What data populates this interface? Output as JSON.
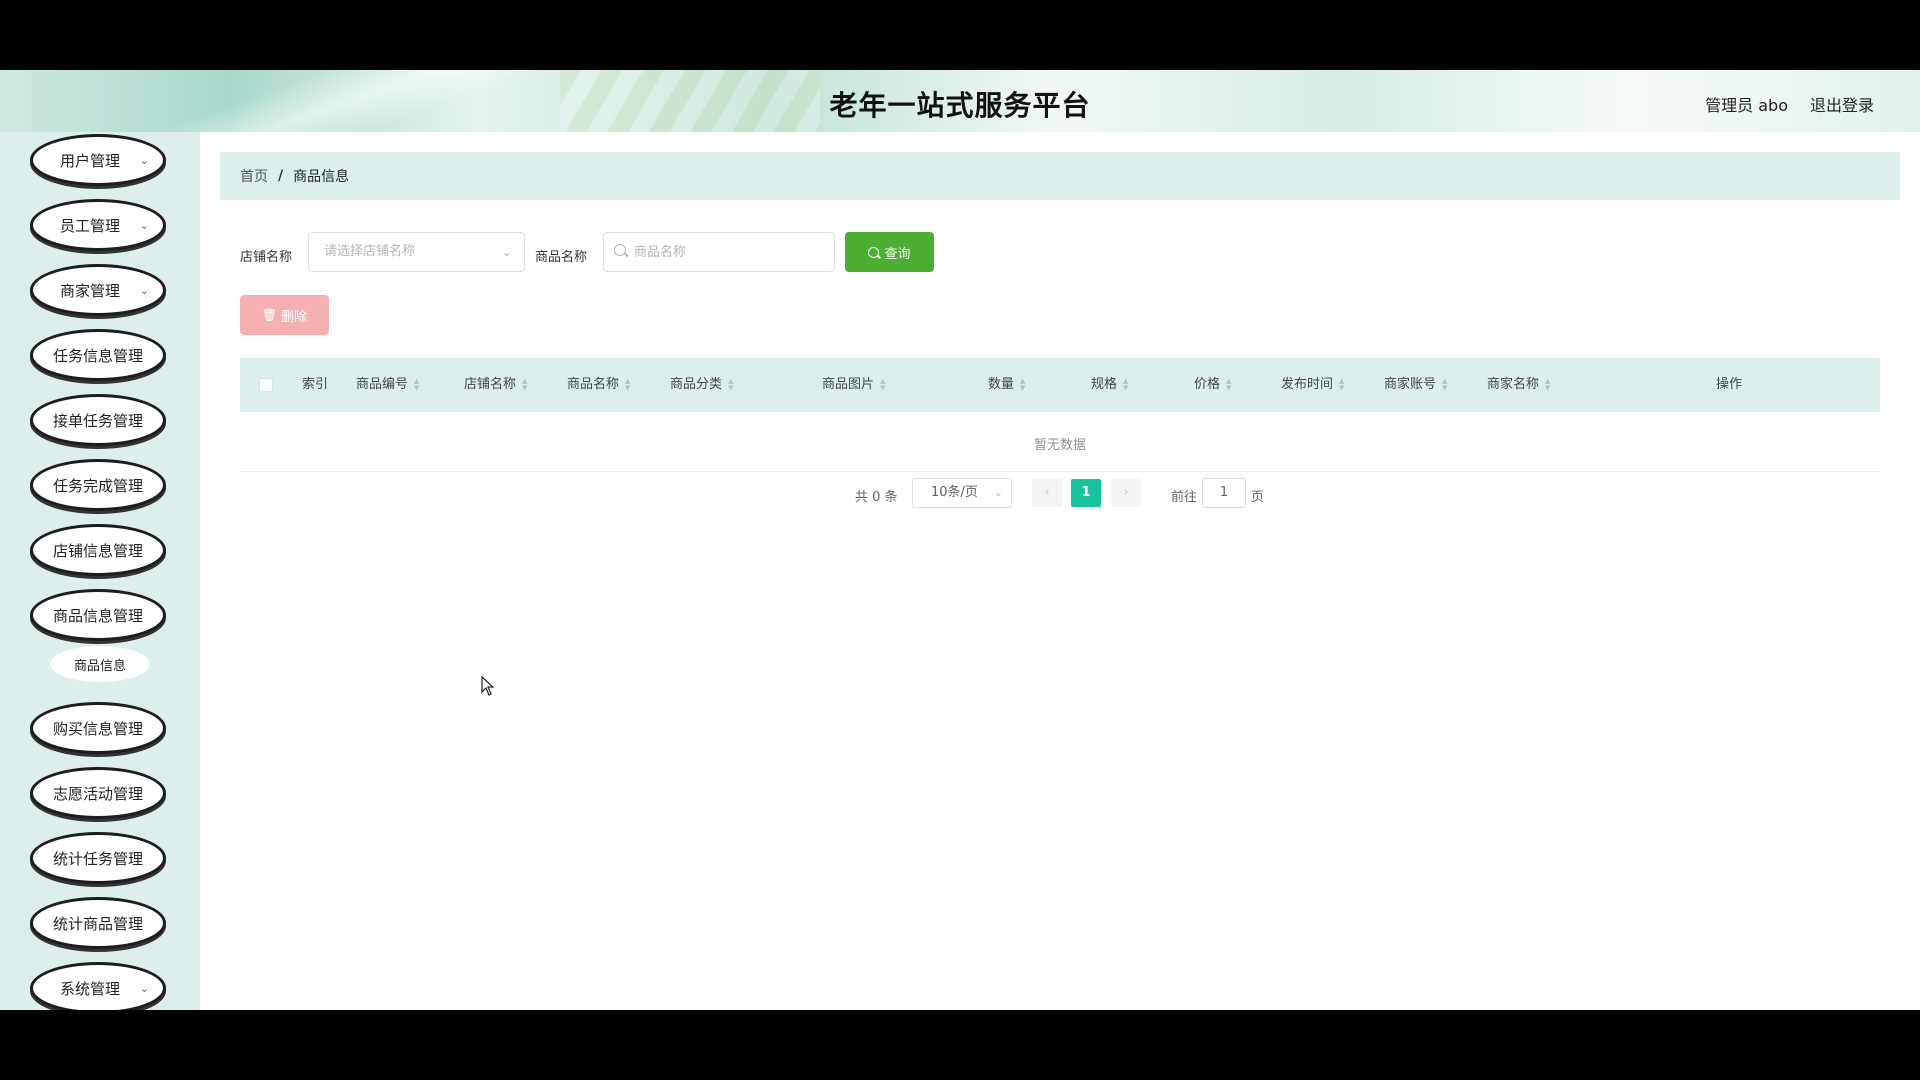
{
  "header": {
    "title": "老年一站式服务平台",
    "user": "管理员 abo",
    "logout": "退出登录"
  },
  "sidebar": {
    "items": [
      {
        "label": "用户管理",
        "has_sub": true
      },
      {
        "label": "员工管理",
        "has_sub": true
      },
      {
        "label": "商家管理",
        "has_sub": true
      },
      {
        "label": "任务信息管理",
        "has_sub": false
      },
      {
        "label": "接单任务管理",
        "has_sub": false
      },
      {
        "label": "任务完成管理",
        "has_sub": false
      },
      {
        "label": "店铺信息管理",
        "has_sub": false
      },
      {
        "label": "商品信息管理",
        "has_sub": false
      },
      {
        "label": "购买信息管理",
        "has_sub": false
      },
      {
        "label": "志愿活动管理",
        "has_sub": false
      },
      {
        "label": "统计任务管理",
        "has_sub": false
      },
      {
        "label": "统计商品管理",
        "has_sub": false
      },
      {
        "label": "系统管理",
        "has_sub": true
      }
    ],
    "submenu": {
      "label": "商品信息"
    }
  },
  "breadcrumb": {
    "home": "首页",
    "separator": "/",
    "current": "商品信息"
  },
  "filters": {
    "shop_label": "店铺名称",
    "shop_placeholder": "请选择店铺名称",
    "product_label": "商品名称",
    "product_placeholder": "商品名称",
    "query_button": "查询",
    "delete_button": "删除"
  },
  "table": {
    "columns": [
      "索引",
      "商品编号",
      "店铺名称",
      "商品名称",
      "商品分类",
      "商品图片",
      "数量",
      "规格",
      "价格",
      "发布时间",
      "商家账号",
      "商家名称",
      "操作"
    ],
    "empty_text": "暂无数据"
  },
  "pagination": {
    "total": "共 0 条",
    "page_size": "10条/页",
    "current_page": "1",
    "goto_label": "前往",
    "goto_value": "1",
    "page_suffix": "页"
  },
  "colors": {
    "accent_green": "#4caf34",
    "page_active": "#18c29c",
    "delete_disabled": "#f5b1b1",
    "panel_bg": "#dcefec"
  }
}
